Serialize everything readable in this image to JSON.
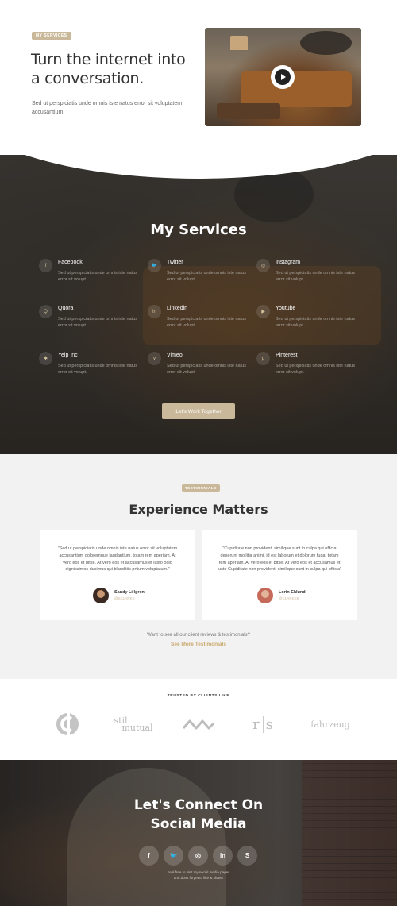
{
  "hero": {
    "tag": "MY SERVICES",
    "title": "Turn the internet into a conversation.",
    "text": "Sed ut perspiciatis unde omnis iste natus error sit voluptatem accusantium.",
    "video_icon": "play-icon"
  },
  "services": {
    "title": "My Services",
    "items": [
      {
        "name": "Facebook",
        "icon": "facebook-icon",
        "glyph": "f",
        "desc": "Sed ut perspiciatis unde omnis iste natus error sit volupt."
      },
      {
        "name": "Twitter",
        "icon": "twitter-icon",
        "glyph": "🐦",
        "desc": "Sed ut perspiciatis unde omnis iste natus error sit volupt."
      },
      {
        "name": "Instagram",
        "icon": "instagram-icon",
        "glyph": "◎",
        "desc": "Sed ut perspiciatis unde omnis iste natus error sit volupt."
      },
      {
        "name": "Quora",
        "icon": "quora-icon",
        "glyph": "Q",
        "desc": "Sed ut perspiciatis unde omnis iste natus error sit volupt."
      },
      {
        "name": "Linkedin",
        "icon": "linkedin-icon",
        "glyph": "in",
        "desc": "Sed ut perspiciatis unde omnis iste natus error sit volupt."
      },
      {
        "name": "Youtube",
        "icon": "youtube-icon",
        "glyph": "▶",
        "desc": "Sed ut perspiciatis unde omnis iste natus error sit volupt."
      },
      {
        "name": "Yelp Inc",
        "icon": "yelp-icon",
        "glyph": "✱",
        "desc": "Sed ut perspiciatis unde omnis iste natus error sit volupt."
      },
      {
        "name": "Vimeo",
        "icon": "vimeo-icon",
        "glyph": "v",
        "desc": "Sed ut perspiciatis unde omnis iste natus error sit volupt."
      },
      {
        "name": "Pinterest",
        "icon": "pinterest-icon",
        "glyph": "p",
        "desc": "Sed ut perspiciatis unde omnis iste natus error sit volupt."
      }
    ],
    "cta": "Let's Work Together"
  },
  "testimonials": {
    "tag": "TESTIMONIALS",
    "title": "Experience Matters",
    "cards": [
      {
        "quote": "\"Sed ut perspiciatis unde omnis iste natus error sit voluptatem accusantium doloremque laudantium, totam rem aperiam. At vero eos et bitse. At vero eos et accusamus et iusto odio dignissimos ducimus qui blanditiis prtium voluptatum.\"",
        "name": "Sandy Lillgren",
        "handle": "@SCLARKE"
      },
      {
        "quote": "\"Cupiditate non provident, similique sunt in culpa qui officia deserunt mollitia animi, id est laborum et dolorum fuga. totam rem aperiam. At vero eos et bitse. At vero eos et accusamus et iusto Cupiditate non provident, similique sunt in culpa qui officia\"",
        "name": "Lorin Eklund",
        "handle": "@CLARKE8"
      }
    ],
    "question": "Want to see all our client reviews & testimonials?",
    "link": "See More Testimonials"
  },
  "trusted": {
    "label": "TRUSTED BY CLIENTS LIKE",
    "logos": [
      "circle-c-logo",
      "stil-mutual-logo",
      "wave-logo",
      "rs-logo",
      "fahrzeug-logo"
    ],
    "logo_texts": {
      "stil": "stil",
      "mutual": "mutual",
      "fahrzeug": "fahrzeug",
      "r": "r",
      "s": "s"
    }
  },
  "social": {
    "title_line1": "Let's Connect On",
    "title_line2": "Social Media",
    "buttons": [
      {
        "icon": "facebook-icon",
        "glyph": "f"
      },
      {
        "icon": "twitter-icon",
        "glyph": "🐦"
      },
      {
        "icon": "instagram-icon",
        "glyph": "◎"
      },
      {
        "icon": "linkedin-icon",
        "glyph": "in"
      },
      {
        "icon": "skype-icon",
        "glyph": "S"
      }
    ],
    "note_line1": "Feel free to visit my social media pages",
    "note_line2": "and don't forget to like & share!"
  },
  "colors": {
    "accent": "#c9b99a",
    "link": "#c9a86a"
  }
}
